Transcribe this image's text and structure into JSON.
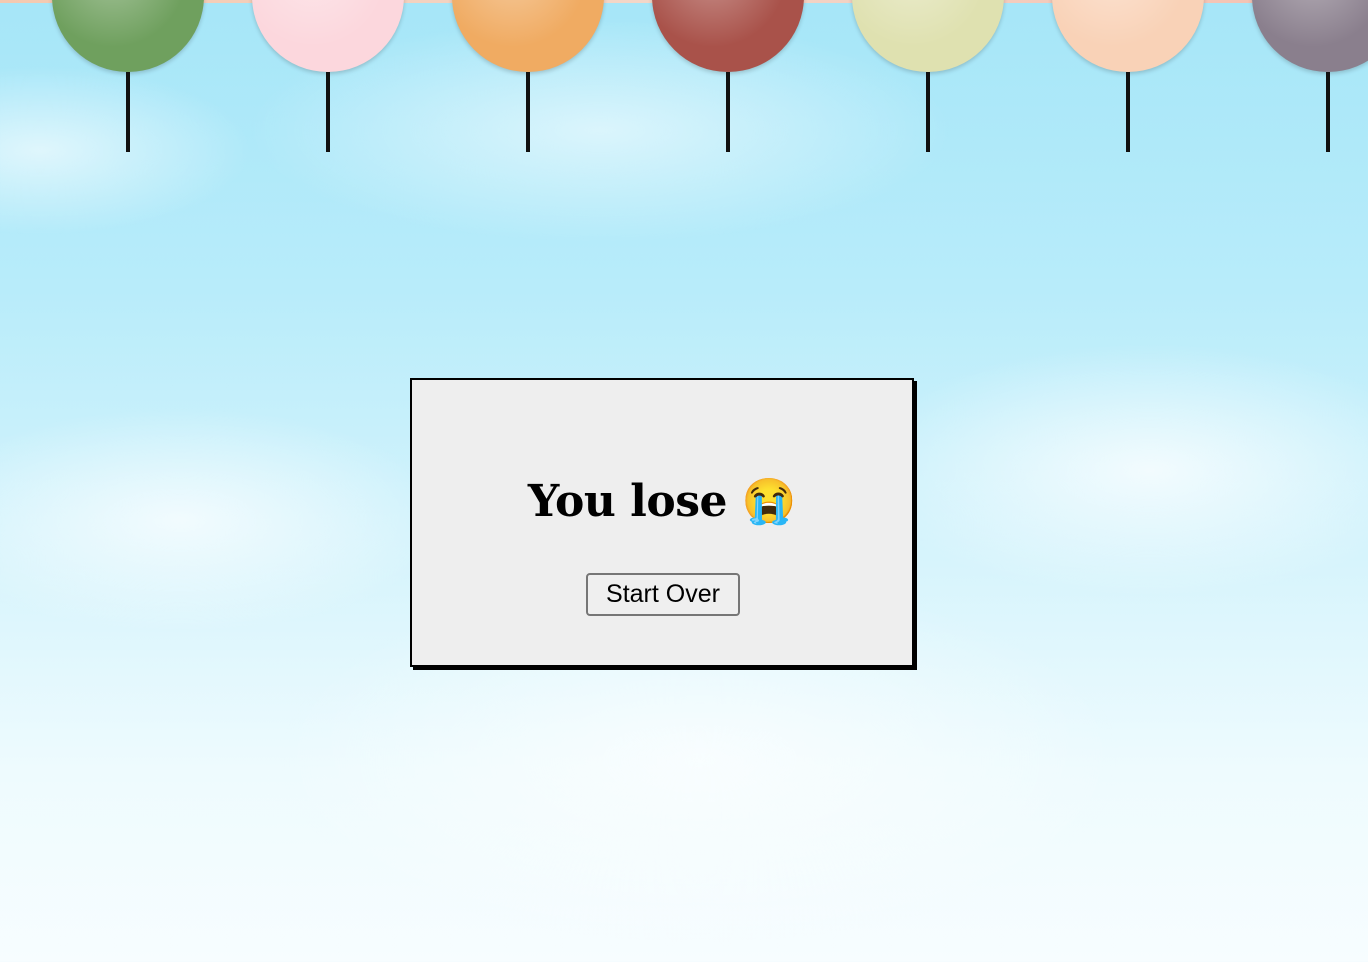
{
  "balloons": [
    {
      "color": "#6fa05e",
      "name": "green-balloon"
    },
    {
      "color": "#fcd7dd",
      "name": "pink-balloon"
    },
    {
      "color": "#f0ab62",
      "name": "orange-balloon"
    },
    {
      "color": "#a9524a",
      "name": "red-balloon"
    },
    {
      "color": "#dfe1b0",
      "name": "lime-balloon"
    },
    {
      "color": "#f9d2b7",
      "name": "peach-balloon"
    },
    {
      "color": "#8a7f8d",
      "name": "purple-balloon"
    }
  ],
  "dialog": {
    "message": "You lose 😭",
    "start_over_label": "Start Over"
  },
  "colors": {
    "sky_top": "#a6e6f8",
    "sky_bottom": "#f7fdff",
    "dialog_bg": "#eeeeee"
  }
}
